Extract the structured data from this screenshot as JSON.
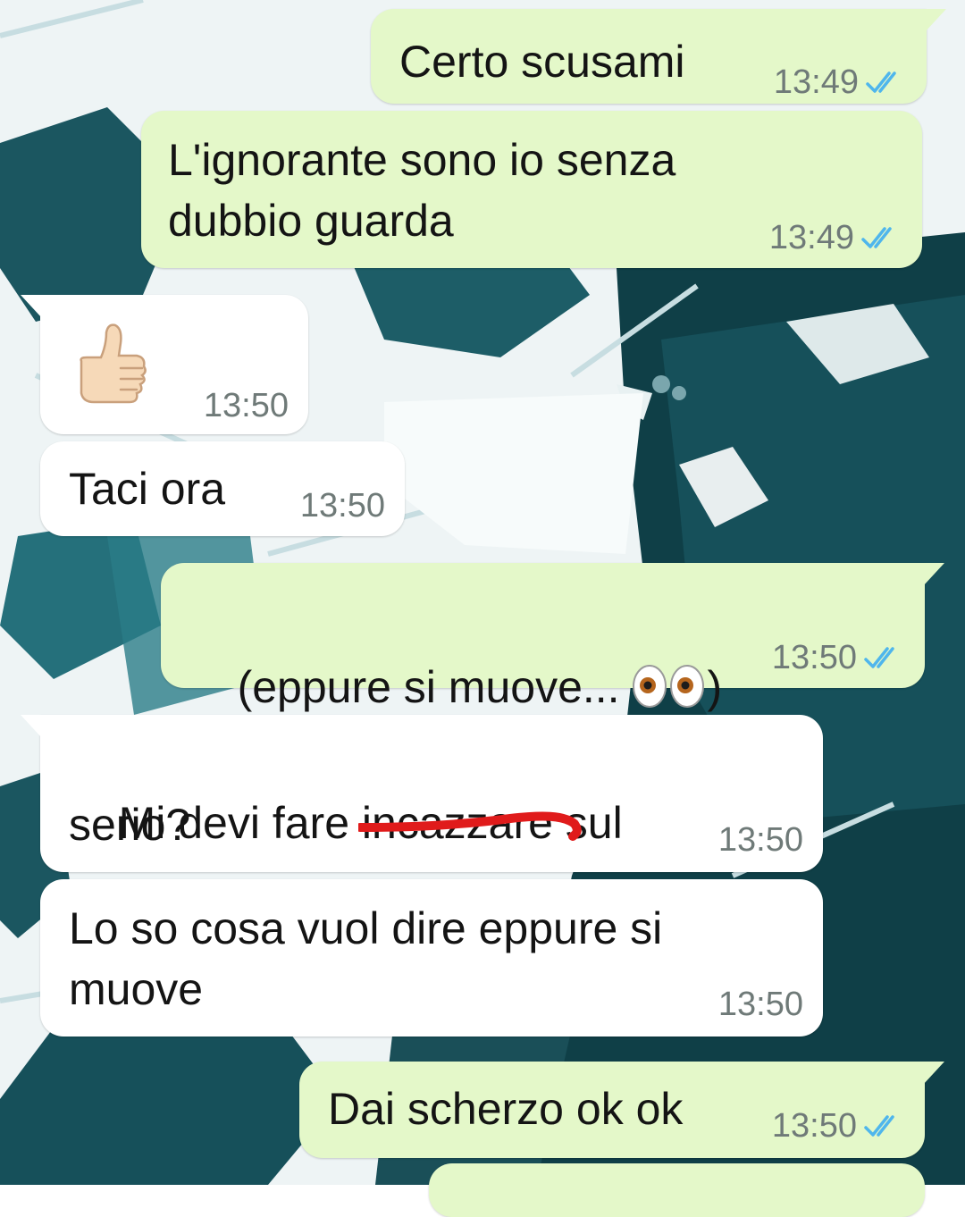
{
  "chat": {
    "messages": [
      {
        "direction": "out",
        "text": "Certo scusami",
        "time": "13:49",
        "status": "read"
      },
      {
        "direction": "out",
        "text": "L'ignorante sono io senza dubbio guarda",
        "line1": "L'ignorante sono io senza",
        "line2": "dubbio guarda",
        "time": "13:49",
        "status": "read"
      },
      {
        "direction": "in",
        "emoji": "thumbs-up-icon",
        "time": "13:50"
      },
      {
        "direction": "in",
        "text": "Taci ora",
        "time": "13:50"
      },
      {
        "direction": "out",
        "text_before": "(eppure si muove... ",
        "emoji": "eyes-icon",
        "text_after": ")",
        "time": "13:50",
        "status": "read"
      },
      {
        "direction": "in",
        "before": "Mi devi fare ",
        "struck": "incazzare",
        "after": " sul",
        "line2": "serio?",
        "time": "13:50"
      },
      {
        "direction": "in",
        "line1": "Lo so cosa vuol dire eppure si",
        "line2": "muove",
        "time": "13:50"
      },
      {
        "direction": "out",
        "text": "Dai scherzo ok ok",
        "time": "13:50",
        "status": "read"
      }
    ]
  },
  "colors": {
    "outgoing_bubble": "#e4f8c9",
    "incoming_bubble": "#ffffff",
    "read_ticks": "#4fb6ec",
    "timestamp": "#6f7a78",
    "scribble": "#e01b1b",
    "ice": "#eef4f5",
    "water": "#0f3f47"
  },
  "icons": {
    "read_receipt": "double-check-icon",
    "wallpaper": "ice-floe-wallpaper"
  }
}
